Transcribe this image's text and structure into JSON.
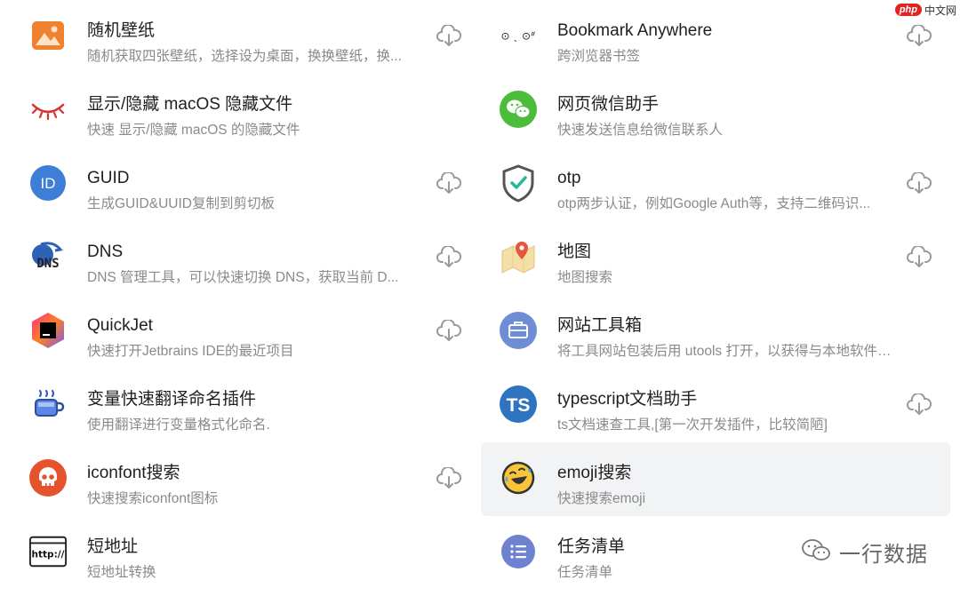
{
  "watermark_top": {
    "badge": "php",
    "text": "中文网"
  },
  "watermark_bottom": {
    "text": "一行数据"
  },
  "left": [
    {
      "title": "随机壁纸",
      "desc": "随机获取四张壁纸，选择设为桌面，换换壁纸，换...",
      "icon": "landscape-image-icon",
      "download": true
    },
    {
      "title": "显示/隐藏 macOS 隐藏文件",
      "desc": "快速 显示/隐藏 macOS 的隐藏文件",
      "icon": "closed-eye-icon",
      "download": false
    },
    {
      "title": "GUID",
      "desc": "生成GUID&UUID复制到剪切板",
      "icon": "id-badge-icon",
      "icon_text": "ID",
      "download": true
    },
    {
      "title": "DNS",
      "desc": "DNS 管理工具，可以快速切换 DNS，获取当前 D...",
      "icon": "dns-icon",
      "icon_text": "DNS",
      "download": true
    },
    {
      "title": "QuickJet",
      "desc": "快速打开Jetbrains IDE的最近项目",
      "icon": "jetbrains-icon",
      "download": true
    },
    {
      "title": "变量快速翻译命名插件",
      "desc": "使用翻译进行变量格式化命名.",
      "icon": "coffee-cup-icon",
      "download": false
    },
    {
      "title": "iconfont搜索",
      "desc": "快速搜索iconfont图标",
      "icon": "skull-icon",
      "download": true
    },
    {
      "title": "短地址",
      "desc": "短地址转换",
      "icon": "http-icon",
      "icon_text": "http://",
      "download": false
    }
  ],
  "right": [
    {
      "title": "Bookmark Anywhere",
      "desc": "跨浏览器书签",
      "icon": "bookmark-face-icon",
      "icon_text": "⊙ ˎ ⊙ᐥ",
      "download": true
    },
    {
      "title": "网页微信助手",
      "desc": "快速发送信息给微信联系人",
      "icon": "wechat-icon",
      "download": false
    },
    {
      "title": "otp",
      "desc": "otp两步认证，例如Google Auth等，支持二维码识...",
      "icon": "shield-check-icon",
      "download": true
    },
    {
      "title": "地图",
      "desc": "地图搜索",
      "icon": "map-pin-icon",
      "download": true
    },
    {
      "title": "网站工具箱",
      "desc": "将工具网站包装后用 utools 打开，以获得与本地软件相...",
      "icon": "toolbox-icon",
      "download": false
    },
    {
      "title": "typescript文档助手",
      "desc": "ts文档速查工具,[第一次开发插件，比较简陋]",
      "icon": "typescript-icon",
      "icon_text": "TS",
      "download": true
    },
    {
      "title": "emoji搜索",
      "desc": "快速搜索emoji",
      "icon": "laughing-emoji-icon",
      "download": false,
      "hover": true
    },
    {
      "title": "任务清单",
      "desc": "任务清单",
      "icon": "list-icon",
      "download": false
    }
  ],
  "colors": {
    "title": "#1f1f1f",
    "desc": "#8a8a8a",
    "hover_bg": "#f2f3f5",
    "download_icon": "#9a9a9a"
  }
}
